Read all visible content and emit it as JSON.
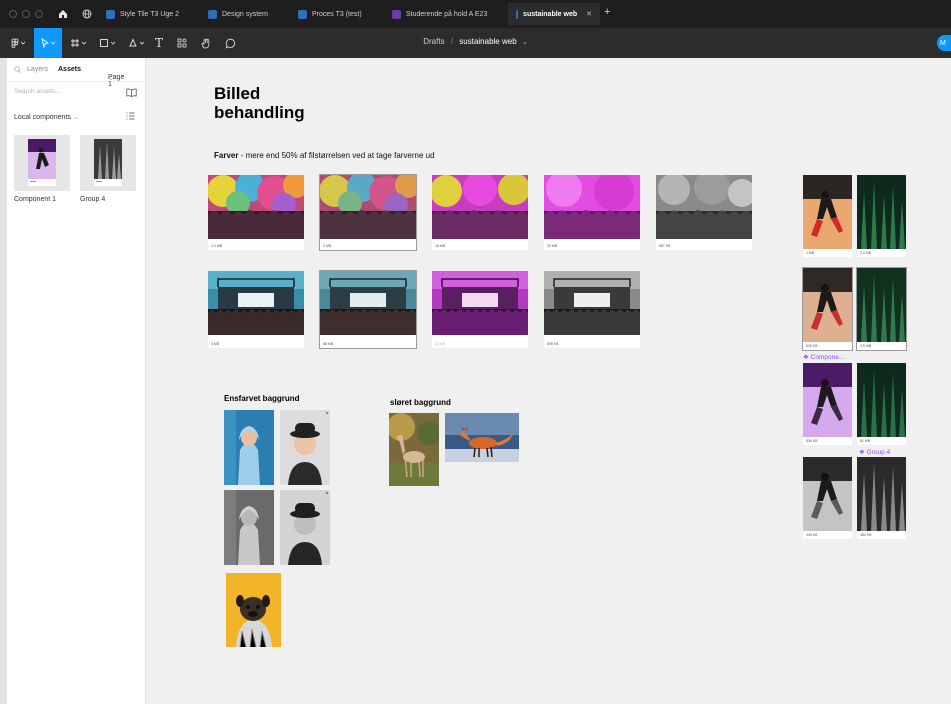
{
  "tabs": [
    {
      "label": "Style Tile T3 Uge 2",
      "favicon": "blue"
    },
    {
      "label": "Design system",
      "favicon": "blue"
    },
    {
      "label": "Proces T3 (test)",
      "favicon": "blue"
    },
    {
      "label": "Studerende på hold A E23",
      "favicon": "purple"
    },
    {
      "label": "sustainable web",
      "favicon": "blue",
      "active": true
    }
  ],
  "toolbar": {
    "breadcrumb_parent": "Drafts",
    "breadcrumb_sep": "/",
    "breadcrumb_file": "sustainable web",
    "text_tool_glyph": "T",
    "avatar_initial": "M"
  },
  "sidebar": {
    "tab_layers": "Layers",
    "tab_assets": "Assets",
    "page_selector": "Page 1",
    "search_placeholder": "Search assets...",
    "local_components": "Local components",
    "components": [
      {
        "label": "Component 1"
      },
      {
        "label": "Group 4"
      }
    ]
  },
  "canvas": {
    "title_line1": "Billed",
    "title_line2": "behandling",
    "subtitle_bold": "Farver",
    "subtitle_rest": " - mere end 50% af filstørrelsen ved at tage farverne ud",
    "row1_sizes": [
      "2,3 MB",
      "2 MB",
      "18 MB",
      "33 MB",
      "887 KB"
    ],
    "row2_sizes": [
      "3 MB",
      "58 MB",
      "18 MB",
      "898 KB"
    ],
    "section_solid": "Ensfarvet baggrund",
    "section_blur": "sløret baggrund",
    "right_label_component": "❖ Compone...",
    "right_label_group": "❖ Group 4",
    "right_sizes": [
      "1 MB",
      "2,3 MB",
      "825 KB",
      "3,5 MB",
      "836 KB",
      "61 MB",
      "445 KB",
      "384 KB"
    ]
  },
  "colors": {
    "accent": "#0d99ff",
    "component_purple": "#9747ff",
    "chrome_dark": "#1e1e1e",
    "toolbar": "#2c2c2c"
  }
}
